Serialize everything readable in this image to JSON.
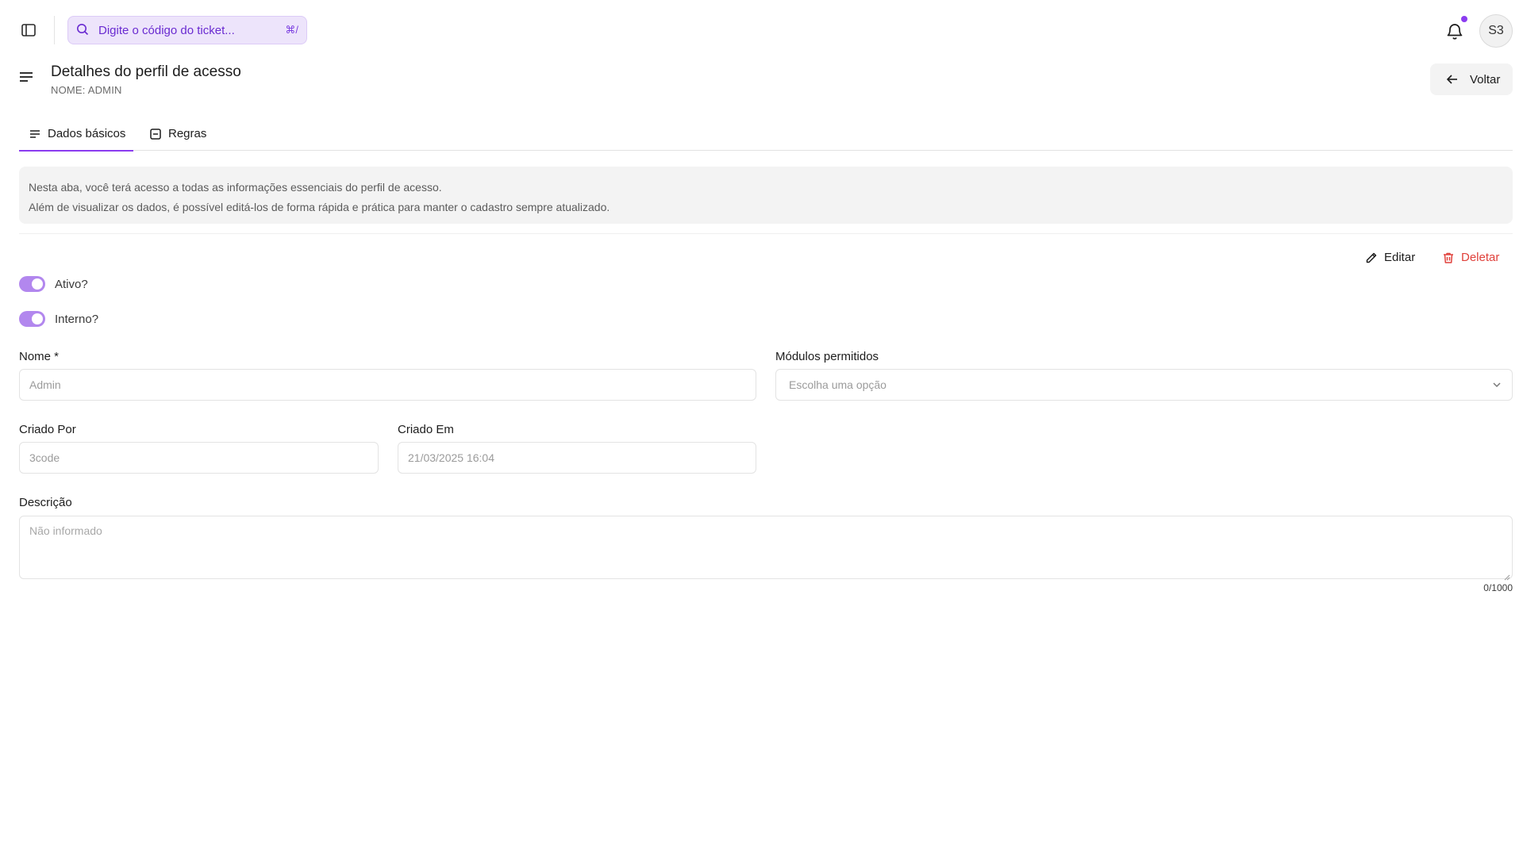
{
  "topbar": {
    "search_placeholder": "Digite o código do ticket...",
    "search_shortcut": "⌘/",
    "avatar_initials": "S3"
  },
  "header": {
    "title": "Detalhes do perfil de acesso",
    "subtitle": "NOME: ADMIN",
    "back_label": "Voltar"
  },
  "tabs": [
    {
      "label": "Dados básicos",
      "active": true
    },
    {
      "label": "Regras",
      "active": false
    }
  ],
  "info": {
    "line1": "Nesta aba, você terá acesso a todas as informações essenciais do perfil de acesso.",
    "line2": "Além de visualizar os dados, é possível editá-los de forma rápida e prática para manter o cadastro sempre atualizado."
  },
  "actions": {
    "edit_label": "Editar",
    "delete_label": "Deletar"
  },
  "toggles": [
    {
      "label": "Ativo?",
      "checked": true
    },
    {
      "label": "Interno?",
      "checked": true
    }
  ],
  "form": {
    "name": {
      "label": "Nome *",
      "value": "Admin"
    },
    "modules": {
      "label": "Módulos permitidos",
      "placeholder": "Escolha uma opção"
    },
    "created_by": {
      "label": "Criado Por",
      "value": "3code"
    },
    "created_at": {
      "label": "Criado Em",
      "value": "21/03/2025 16:04"
    },
    "description": {
      "label": "Descrição",
      "placeholder": "Não informado",
      "counter": "0/1000"
    }
  },
  "colors": {
    "accent": "#8b3cf0",
    "toggle_on": "#b287ee",
    "search_bg": "#ede4fb",
    "danger": "#e0413b"
  }
}
